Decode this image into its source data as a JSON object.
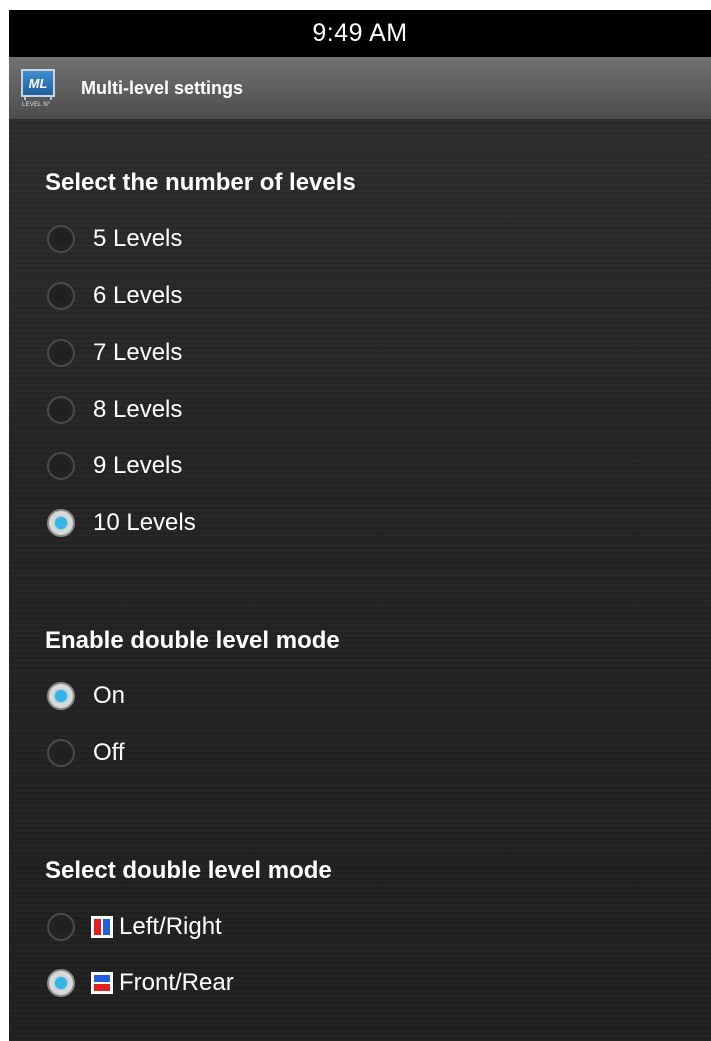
{
  "status_bar": {
    "time": "9:49 AM"
  },
  "action_bar": {
    "logo_text": "ML",
    "logo_caption": "LEVEL N°",
    "title": "Multi-level settings"
  },
  "levels": {
    "title": "Select the number of levels",
    "options": [
      {
        "label": "5 Levels",
        "selected": false
      },
      {
        "label": "6 Levels",
        "selected": false
      },
      {
        "label": "7 Levels",
        "selected": false
      },
      {
        "label": "8 Levels",
        "selected": false
      },
      {
        "label": "9 Levels",
        "selected": false
      },
      {
        "label": "10 Levels",
        "selected": true
      }
    ]
  },
  "double_level": {
    "title": "Enable double level mode",
    "options": [
      {
        "label": "On",
        "selected": true
      },
      {
        "label": "Off",
        "selected": false
      }
    ]
  },
  "double_mode": {
    "title": "Select double level mode",
    "options": [
      {
        "label": "Left/Right",
        "icon": "left-right-split-icon",
        "selected": false
      },
      {
        "label": "Front/Rear",
        "icon": "front-rear-split-icon",
        "selected": true
      }
    ]
  },
  "colors": {
    "accent": "#33b5e5",
    "status_bar": "#000000",
    "background": "#1f1f1f",
    "split_red": "#e02020",
    "split_blue": "#2060e0"
  }
}
